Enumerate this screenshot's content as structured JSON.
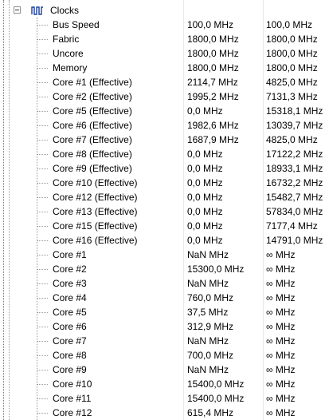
{
  "group": {
    "label": "Clocks",
    "icon": "clock-waveform-icon",
    "expander": "collapse-minus-icon"
  },
  "rows": [
    {
      "name": "Bus Speed",
      "value": "100,0 MHz",
      "max": "100,0 MHz"
    },
    {
      "name": "Fabric",
      "value": "1800,0 MHz",
      "max": "1800,0 MHz"
    },
    {
      "name": "Uncore",
      "value": "1800,0 MHz",
      "max": "1800,0 MHz"
    },
    {
      "name": "Memory",
      "value": "1800,0 MHz",
      "max": "1800,0 MHz"
    },
    {
      "name": "Core #1 (Effective)",
      "value": "2114,7 MHz",
      "max": "4825,0 MHz"
    },
    {
      "name": "Core #2 (Effective)",
      "value": "1995,2 MHz",
      "max": "7131,3 MHz"
    },
    {
      "name": "Core #5 (Effective)",
      "value": "0,0 MHz",
      "max": "15318,1 MHz"
    },
    {
      "name": "Core #6 (Effective)",
      "value": "1982,6 MHz",
      "max": "13039,7 MHz"
    },
    {
      "name": "Core #7 (Effective)",
      "value": "1687,9 MHz",
      "max": "4825,0 MHz"
    },
    {
      "name": "Core #8 (Effective)",
      "value": "0,0 MHz",
      "max": "17122,2 MHz"
    },
    {
      "name": "Core #9 (Effective)",
      "value": "0,0 MHz",
      "max": "18933,1 MHz"
    },
    {
      "name": "Core #10 (Effective)",
      "value": "0,0 MHz",
      "max": "16732,2 MHz"
    },
    {
      "name": "Core #12 (Effective)",
      "value": "0,0 MHz",
      "max": "15482,7 MHz"
    },
    {
      "name": "Core #13 (Effective)",
      "value": "0,0 MHz",
      "max": "57834,0 MHz"
    },
    {
      "name": "Core #15 (Effective)",
      "value": "0,0 MHz",
      "max": "7177,4 MHz"
    },
    {
      "name": "Core #16 (Effective)",
      "value": "0,0 MHz",
      "max": "14791,0 MHz"
    },
    {
      "name": "Core #1",
      "value": "NaN MHz",
      "max": "∞ MHz"
    },
    {
      "name": "Core #2",
      "value": "15300,0 MHz",
      "max": "∞ MHz"
    },
    {
      "name": "Core #3",
      "value": "NaN MHz",
      "max": "∞ MHz"
    },
    {
      "name": "Core #4",
      "value": "760,0 MHz",
      "max": "∞ MHz"
    },
    {
      "name": "Core #5",
      "value": "37,5 MHz",
      "max": "∞ MHz"
    },
    {
      "name": "Core #6",
      "value": "312,9 MHz",
      "max": "∞ MHz"
    },
    {
      "name": "Core #7",
      "value": "NaN MHz",
      "max": "∞ MHz"
    },
    {
      "name": "Core #8",
      "value": "700,0 MHz",
      "max": "∞ MHz"
    },
    {
      "name": "Core #9",
      "value": "NaN MHz",
      "max": "∞ MHz"
    },
    {
      "name": "Core #10",
      "value": "15400,0 MHz",
      "max": "∞ MHz"
    },
    {
      "name": "Core #11",
      "value": "15400,0 MHz",
      "max": "∞ MHz"
    },
    {
      "name": "Core #12",
      "value": "615,4 MHz",
      "max": "∞ MHz"
    }
  ]
}
